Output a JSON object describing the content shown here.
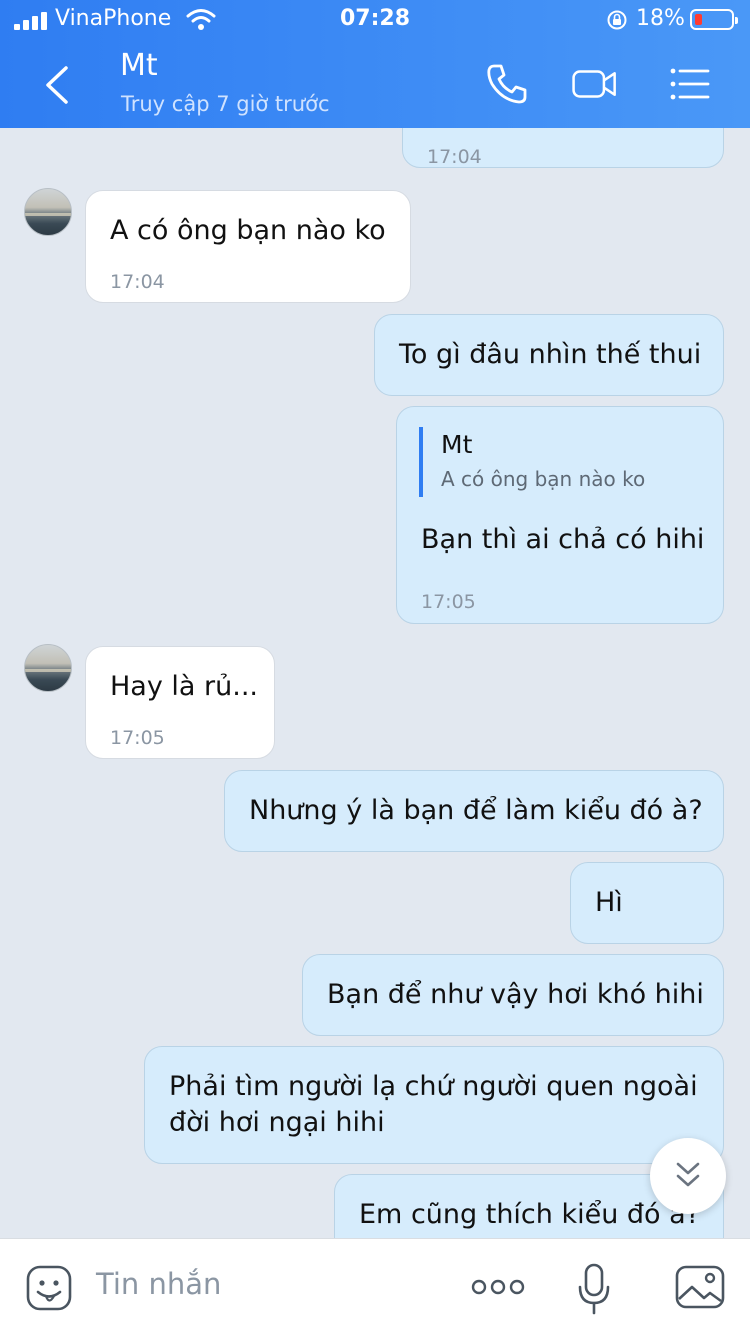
{
  "status_bar": {
    "carrier": "VinaPhone",
    "time": "07:28",
    "battery": "18%",
    "battery_level": 0.18
  },
  "header": {
    "contact_name": "Mt",
    "last_seen": "Truy cập 7 giờ trước",
    "icons": [
      "back-icon",
      "phone-icon",
      "video-icon",
      "menu-icon"
    ]
  },
  "messages": [
    {
      "from": "me",
      "time": "17:04"
    },
    {
      "from": "them",
      "text": "A có ông bạn nào ko",
      "time": "17:04"
    },
    {
      "from": "me",
      "text": "To gì đâu nhìn thế thui"
    },
    {
      "from": "me",
      "quote_name": "Mt",
      "quote_text": "A có ông bạn nào ko",
      "text": "Bạn thì ai chả có hihi",
      "time": "17:05"
    },
    {
      "from": "them",
      "text": "Hay là rủ...",
      "time": "17:05"
    },
    {
      "from": "me",
      "text": "Nhưng ý là bạn để làm kiểu đó à?"
    },
    {
      "from": "me",
      "text": "Hì"
    },
    {
      "from": "me",
      "text": "Bạn để như vậy hơi khó hihi"
    },
    {
      "from": "me",
      "lines": [
        "Phải tìm người lạ chứ người quen ngoài",
        "đời hơi ngại hihi"
      ]
    },
    {
      "from": "me",
      "text": "Em cũng thích kiểu đó à?"
    }
  ],
  "input": {
    "placeholder": "Tin nhắn",
    "icons": [
      "sticker-icon",
      "more-icon",
      "microphone-icon",
      "image-icon"
    ]
  },
  "colors": {
    "header_start": "#2f7df2",
    "header_end": "#4a98f7",
    "chat_background": "#e2e8f0",
    "my_bubble": "#d6ecfc",
    "their_bubble": "#ffffff"
  }
}
